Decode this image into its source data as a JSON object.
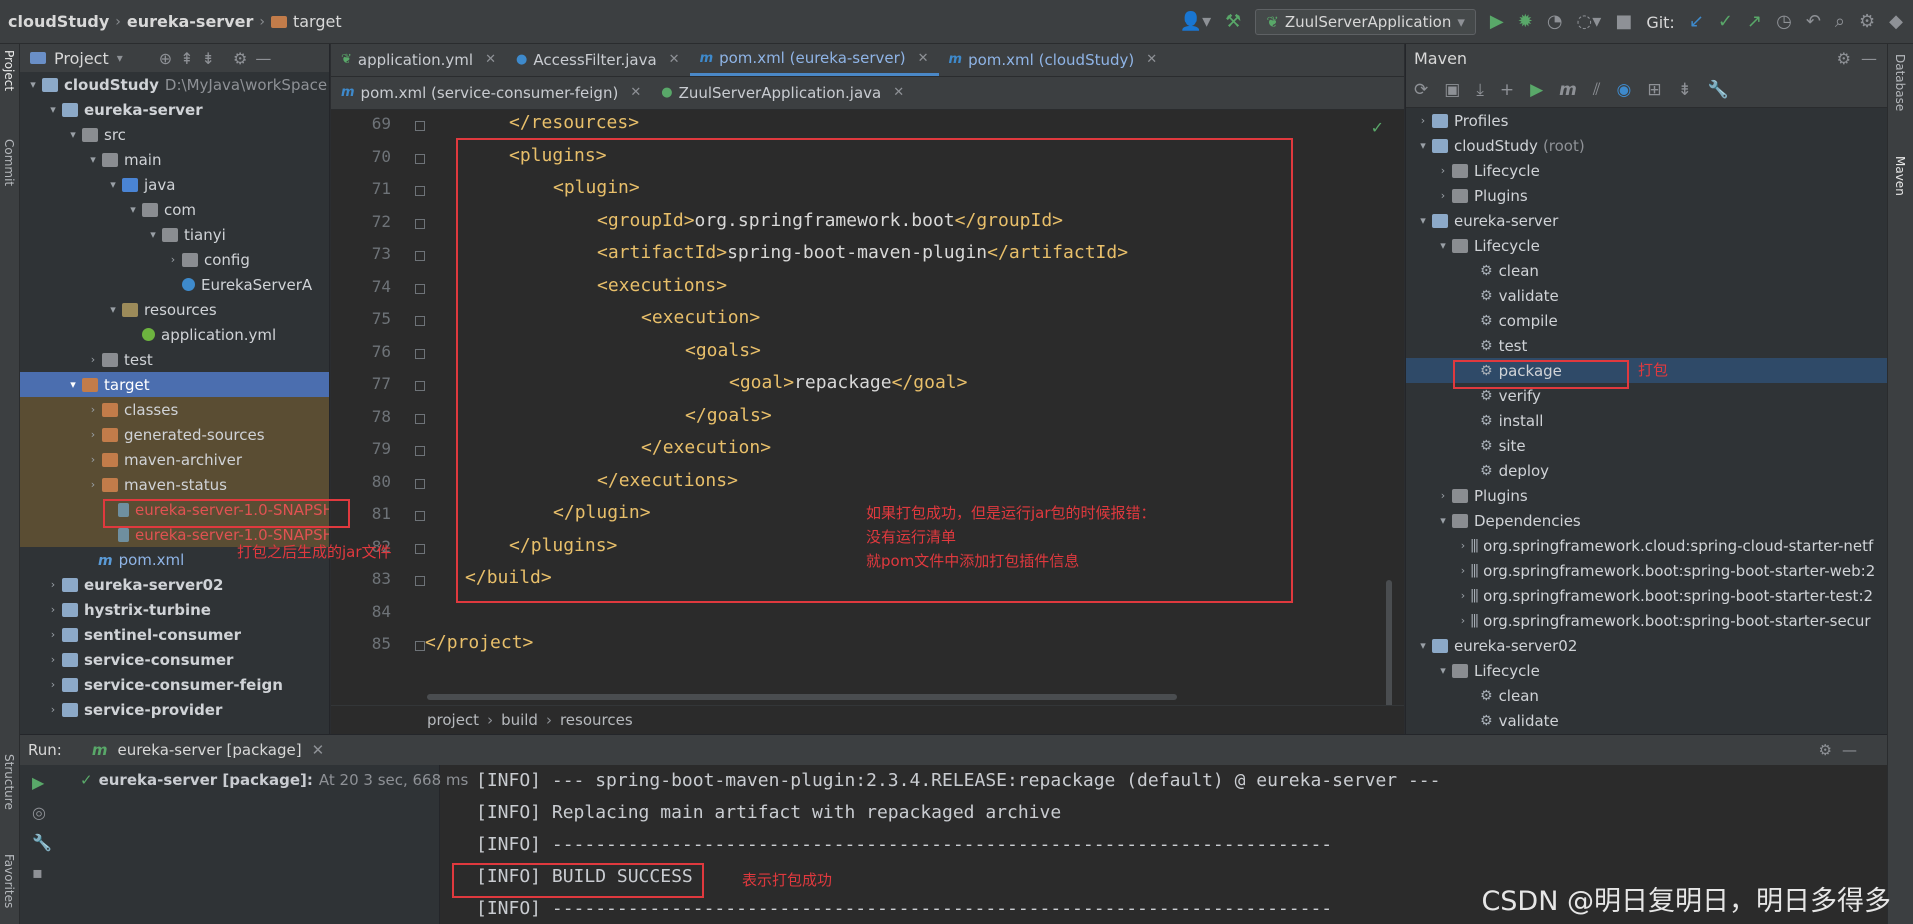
{
  "breadcrumb": {
    "project": "cloudStudy",
    "module": "eureka-server",
    "folder": "target"
  },
  "toolbar": {
    "run_config": "ZuulServerApplication",
    "git_label": "Git:"
  },
  "project_panel": {
    "title": "Project",
    "root_label": "cloudStudy",
    "root_path": "D:\\MyJava\\workSpace",
    "items": [
      "eureka-server",
      "src",
      "main",
      "java",
      "com",
      "tianyi",
      "config",
      "EurekaServerA",
      "resources",
      "application.yml",
      "test",
      "target",
      "classes",
      "generated-sources",
      "maven-archiver",
      "maven-status",
      "eureka-server-1.0-SNAPSH",
      "eureka-server-1.0-SNAPSH",
      "pom.xml",
      "eureka-server02",
      "hystrix-turbine",
      "sentinel-consumer",
      "service-consumer",
      "service-consumer-feign",
      "service-provider"
    ]
  },
  "editor": {
    "tabs_row1": [
      "application.yml",
      "AccessFilter.java",
      "pom.xml (eureka-server)",
      "pom.xml (cloudStudy)"
    ],
    "tabs_row2": [
      "pom.xml (service-consumer-feign)",
      "ZuulServerApplication.java"
    ],
    "line_numbers": [
      "69",
      "70",
      "71",
      "72",
      "73",
      "74",
      "75",
      "76",
      "77",
      "78",
      "79",
      "80",
      "81",
      "82",
      "83",
      "84",
      "85"
    ],
    "lines": [
      {
        "open": "</",
        "name": "resources",
        "close": ">",
        "text": ""
      },
      {
        "open": "<",
        "name": "plugins",
        "close": ">",
        "text": ""
      },
      {
        "open": "<",
        "name": "plugin",
        "close": ">",
        "text": ""
      },
      {
        "open": "<",
        "name": "groupId",
        "close": ">",
        "text": "org.springframework.boot",
        "end": "</groupId>"
      },
      {
        "open": "<",
        "name": "artifactId",
        "close": ">",
        "text": "spring-boot-maven-plugin",
        "end": "</artifactId>"
      },
      {
        "open": "<",
        "name": "executions",
        "close": ">",
        "text": ""
      },
      {
        "open": "<",
        "name": "execution",
        "close": ">",
        "text": ""
      },
      {
        "open": "<",
        "name": "goals",
        "close": ">",
        "text": ""
      },
      {
        "open": "<",
        "name": "goal",
        "close": ">",
        "text": "repackage",
        "end": "</goal>"
      },
      {
        "open": "</",
        "name": "goals",
        "close": ">",
        "text": ""
      },
      {
        "open": "</",
        "name": "execution",
        "close": ">",
        "text": ""
      },
      {
        "open": "</",
        "name": "executions",
        "close": ">",
        "text": ""
      },
      {
        "open": "</",
        "name": "plugin",
        "close": ">",
        "text": ""
      },
      {
        "open": "</",
        "name": "plugins",
        "close": ">",
        "text": ""
      },
      {
        "open": "</",
        "name": "build",
        "close": ">",
        "text": ""
      },
      {
        "open": "",
        "name": "",
        "close": "",
        "text": ""
      },
      {
        "open": "</",
        "name": "project",
        "close": ">",
        "text": ""
      }
    ],
    "breadcrumb": [
      "project",
      "build",
      "resources"
    ]
  },
  "maven_panel": {
    "title": "Maven",
    "items": [
      "Profiles",
      "cloudStudy",
      "(root)",
      "Lifecycle",
      "Plugins",
      "eureka-server",
      "Lifecycle",
      "clean",
      "validate",
      "compile",
      "test",
      "package",
      "verify",
      "install",
      "site",
      "deploy",
      "Plugins",
      "Dependencies",
      "org.springframework.cloud:spring-cloud-starter-netf",
      "org.springframework.boot:spring-boot-starter-web:2",
      "org.springframework.boot:spring-boot-starter-test:2",
      "org.springframework.boot:spring-boot-starter-secur",
      "eureka-server02",
      "Lifecycle",
      "clean",
      "validate"
    ]
  },
  "run_panel": {
    "label": "Run:",
    "tab": "eureka-server [package]",
    "task": "eureka-server [package]:",
    "task_time": "At 20 3 sec, 668 ms",
    "console": [
      "[INFO] --- spring-boot-maven-plugin:2.3.4.RELEASE:repackage (default) @ eureka-server ---",
      "[INFO] Replacing main artifact with repackaged archive",
      "[INFO] ------------------------------------------------------------------------",
      "[INFO] BUILD SUCCESS",
      "[INFO] ------------------------------------------------------------------------"
    ]
  },
  "side_strips": {
    "left": [
      "Project",
      "Commit",
      "Structure",
      "Favorites"
    ],
    "right": [
      "Database",
      "Maven"
    ]
  },
  "annotations": {
    "package_note": "打包",
    "jar_note": "打包之后生成的jar文件",
    "editor_note": [
      "如果打包成功，但是运行jar包的时候报错：",
      "没有运行清单",
      "就pom文件中添加打包插件信息"
    ],
    "success_note": "表示打包成功",
    "watermark": "CSDN @明日复明日，明日多得多"
  },
  "colors": {
    "accent": "#4a88c7",
    "annotation": "#e0393e",
    "xml_tag": "#e8bf6a",
    "selection": "#4b6eaf"
  }
}
